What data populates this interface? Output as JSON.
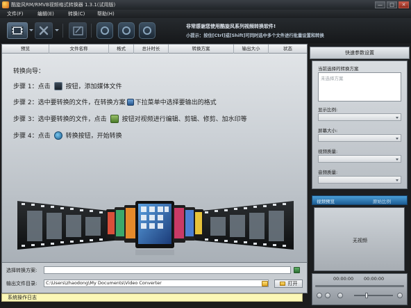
{
  "window": {
    "title": "酷旋风RM/RMVB视频格式转换器 1.3.1(试用版)",
    "buttons": {
      "minimize": "—",
      "maximize": "□",
      "close": "✕"
    }
  },
  "menu": [
    "文件(F)",
    "编辑(E)",
    "转换(C)",
    "帮助(H)"
  ],
  "toolbar": {
    "promo": "非常感谢您使用酷旋风系列视频转换软件!",
    "tip": "小提示：按住[Ctrl]或[Shift]可同时选中多个文件进行批量设置和转换"
  },
  "table": {
    "columns": [
      "预览",
      "文件名称",
      "格式",
      "总计时长",
      "转换方案",
      "输出大小",
      "状态"
    ]
  },
  "guide": {
    "title": "转换向导：",
    "step1": {
      "prefix": "步骤 1：点击",
      "suffix": "按钮，添加媒体文件"
    },
    "step2": {
      "prefix": "步骤 2：选中要转换的文件，在转换方案",
      "suffix": "下拉菜单中选择要输出的格式"
    },
    "step3": {
      "prefix": "步骤 3：选中要转换的文件，点击",
      "suffix": "按钮对视频进行编辑、剪辑、修剪、加水印等"
    },
    "step4": {
      "prefix": "步骤 4：点击",
      "suffix": "转换按钮，开始转换"
    }
  },
  "bottom": {
    "scheme_label": "选择转换方案:",
    "scheme_value": "",
    "output_label": "输出文件目录:",
    "output_value": "C:\\Users\\zhaodong\\My Documents\\Video Converter",
    "open_button": "打开",
    "log": "系统操作日志"
  },
  "right_panel": {
    "header": "快速参数设置",
    "current_scheme_label": "当前选择的转换方案",
    "scheme_placeholder": "未选择方案",
    "display_ratio_label": "显示比例:",
    "screen_size_label": "屏幕大小:",
    "video_quality_label": "视频质量:",
    "audio_quality_label": "音频质量:",
    "preview_title": "视频预览",
    "original_ratio": "原始比例",
    "no_video": "无视频",
    "time_current": "00:00:00",
    "time_total": "00:00:00"
  }
}
